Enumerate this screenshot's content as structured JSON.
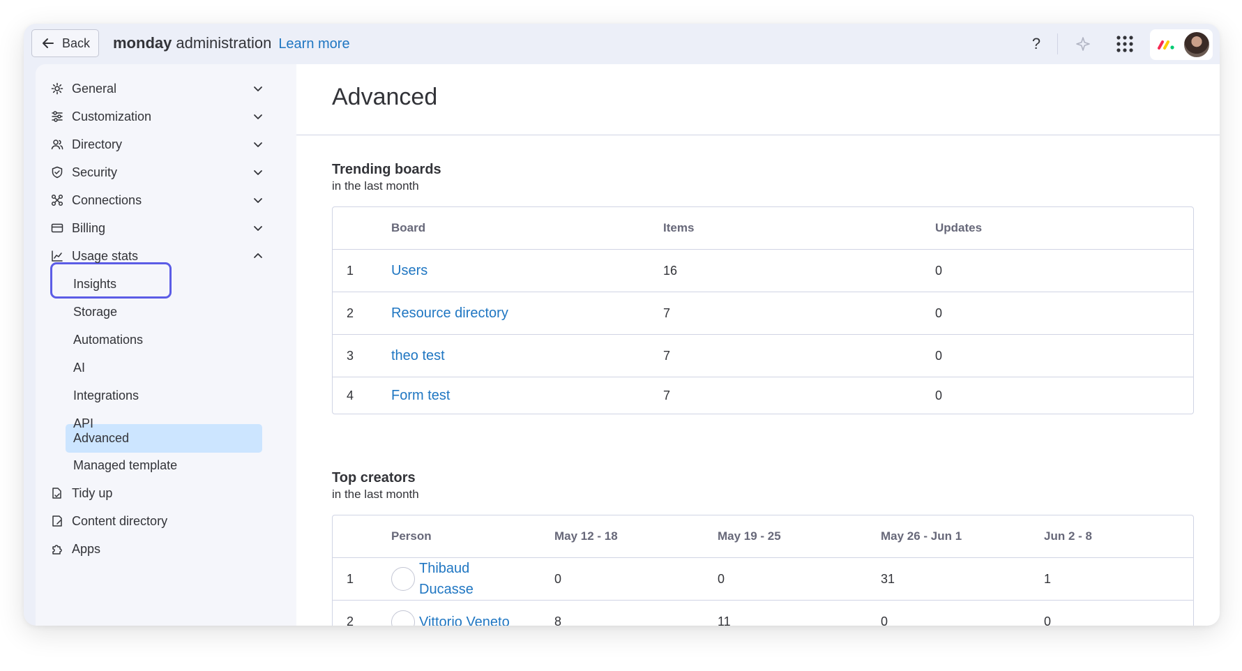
{
  "header": {
    "back_label": "Back",
    "title_bold": "monday",
    "title_rest": "administration",
    "learn_more": "Learn more",
    "help_label": "?"
  },
  "sidebar": {
    "items": [
      {
        "label": "General",
        "icon": "gear-icon"
      },
      {
        "label": "Customization",
        "icon": "sliders-icon"
      },
      {
        "label": "Directory",
        "icon": "users-icon"
      },
      {
        "label": "Security",
        "icon": "shield-icon"
      },
      {
        "label": "Connections",
        "icon": "connections-icon"
      },
      {
        "label": "Billing",
        "icon": "credit-card-icon"
      },
      {
        "label": "Usage stats",
        "icon": "chart-icon"
      }
    ],
    "usage_sub": [
      "Insights",
      "Storage",
      "Automations",
      "AI",
      "Integrations",
      "API",
      "Advanced",
      "Managed template"
    ],
    "bottom_items": [
      {
        "label": "Tidy up",
        "icon": "broom-icon"
      },
      {
        "label": "Content directory",
        "icon": "content-icon"
      },
      {
        "label": "Apps",
        "icon": "puzzle-icon"
      }
    ]
  },
  "main": {
    "title": "Advanced",
    "trending": {
      "title": "Trending boards",
      "subtitle": "in the last month",
      "headers": [
        "Board",
        "Items",
        "Updates"
      ],
      "rows": [
        {
          "rank": "1",
          "board": "Users",
          "items": "16",
          "updates": "0"
        },
        {
          "rank": "2",
          "board": "Resource directory",
          "items": "7",
          "updates": "0"
        },
        {
          "rank": "3",
          "board": "theo test",
          "items": "7",
          "updates": "0"
        },
        {
          "rank": "4",
          "board": "Form test",
          "items": "7",
          "updates": "0"
        }
      ]
    },
    "creators": {
      "title": "Top creators",
      "subtitle": "in the last month",
      "headers": [
        "Person",
        "May 12 - 18",
        "May 19 - 25",
        "May 26 - Jun 1",
        "Jun 2 - 8"
      ],
      "rows": [
        {
          "rank": "1",
          "first": "Thibaud",
          "last": "Ducasse",
          "w1": "0",
          "w2": "0",
          "w3": "31",
          "w4": "1"
        },
        {
          "rank": "2",
          "first": "Vittorio Veneto",
          "last": "",
          "w1": "8",
          "w2": "11",
          "w3": "0",
          "w4": "0"
        }
      ]
    }
  },
  "colors": {
    "accent": "#5b5ce6",
    "link": "#1f76c2",
    "active_bg": "#cce5ff"
  }
}
